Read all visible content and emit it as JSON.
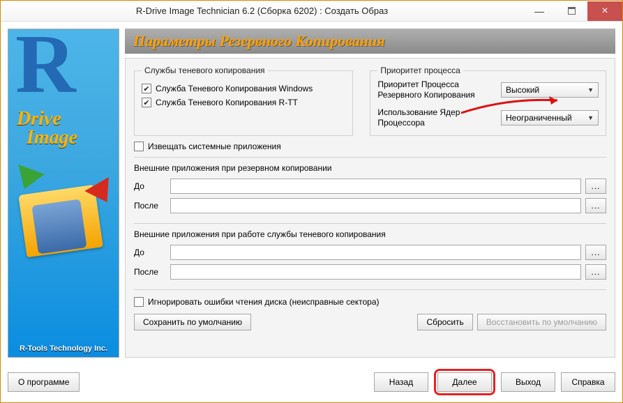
{
  "window": {
    "title": "R-Drive Image Technician 6.2 (Сборка 6202) : Создать Образ"
  },
  "sidebar": {
    "brand_line1": "Drive",
    "brand_line2": "Image",
    "footer": "R-Tools Technology Inc."
  },
  "header": {
    "title": "Параметры Резервного Копирования"
  },
  "shadow_copy": {
    "legend": "Службы теневого копирования",
    "opt_windows": "Служба Теневого Копирования Windows",
    "opt_rtt": "Служба Теневого Копирования R-TT",
    "opt_windows_checked": true,
    "opt_rtt_checked": true
  },
  "priority": {
    "legend": "Приоритет процесса",
    "label_priority": "Приоритет Процесса Резервного Копирования",
    "value_priority": "Высокий",
    "label_cores": "Использование Ядер Процессора",
    "value_cores": "Неограниченный"
  },
  "notify": {
    "label": "Извещать системные приложения",
    "checked": false
  },
  "ext_backup": {
    "title": "Внешние приложения при резервном копировании",
    "label_before": "До",
    "label_after": "После",
    "value_before": "",
    "value_after": "",
    "browse": "..."
  },
  "ext_shadow": {
    "title": "Внешние приложения при работе службы теневого копирования",
    "label_before": "До",
    "label_after": "После",
    "value_before": "",
    "value_after": "",
    "browse": "..."
  },
  "ignore": {
    "label": "Игнорировать ошибки чтения диска (неисправные сектора)",
    "checked": false
  },
  "defaults": {
    "save": "Сохранить по умолчанию",
    "reset": "Сбросить",
    "restore": "Восстановить по умолчанию"
  },
  "bottom": {
    "about": "О программе",
    "back": "Назад",
    "next": "Далее",
    "exit": "Выход",
    "help": "Справка"
  }
}
